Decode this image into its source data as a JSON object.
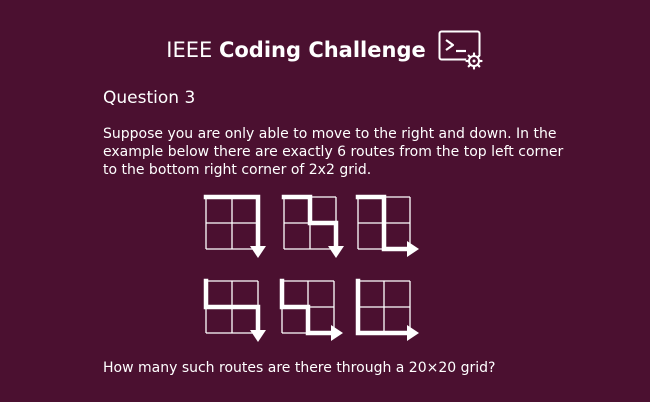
{
  "header": {
    "title_light": "IEEE",
    "title_bold": "Coding Challenge",
    "icon": "terminal-gear-icon"
  },
  "question": {
    "label": "Question 3",
    "description": "Suppose you are only able to move to the right and down. In the example below there are exactly 6 routes from the top left corner to the bottom right corner of 2x2 grid.",
    "prompt": "How many such routes are there through a 20×20 grid?"
  },
  "figure": {
    "grid_size": 2,
    "routes": [
      [
        "R",
        "R",
        "D",
        "D"
      ],
      [
        "R",
        "D",
        "R",
        "D"
      ],
      [
        "R",
        "D",
        "D",
        "R"
      ],
      [
        "D",
        "R",
        "R",
        "D"
      ],
      [
        "D",
        "R",
        "D",
        "R"
      ],
      [
        "D",
        "D",
        "R",
        "R"
      ]
    ]
  },
  "colors": {
    "background": "#4b1030",
    "foreground": "#ffffff"
  }
}
